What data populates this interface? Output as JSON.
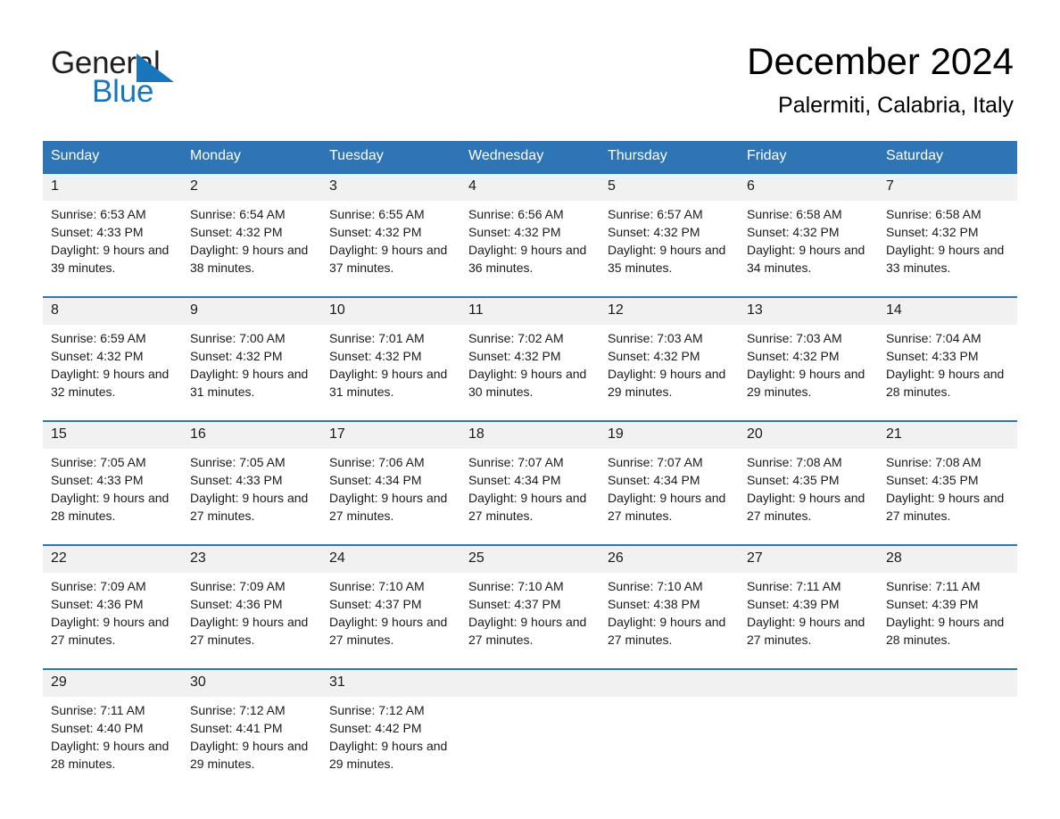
{
  "brand": {
    "name_top": "General",
    "name_bottom": "Blue",
    "triangle_icon": "triangle-logo-mark",
    "black": "#231f20",
    "blue": "#1a76bc"
  },
  "header": {
    "month_title": "December 2024",
    "location": "Palermiti, Calabria, Italy"
  },
  "theme": {
    "header_blue": "#2e75b6",
    "row_band_gray": "#f1f1f1",
    "text": "#1a1a1a"
  },
  "weekday_headers": [
    "Sunday",
    "Monday",
    "Tuesday",
    "Wednesday",
    "Thursday",
    "Friday",
    "Saturday"
  ],
  "weeks": [
    {
      "dates": [
        "1",
        "2",
        "3",
        "4",
        "5",
        "6",
        "7"
      ],
      "cells": [
        {
          "sunrise": "Sunrise: 6:53 AM",
          "sunset": "Sunset: 4:33 PM",
          "daylight": "Daylight: 9 hours and 39 minutes."
        },
        {
          "sunrise": "Sunrise: 6:54 AM",
          "sunset": "Sunset: 4:32 PM",
          "daylight": "Daylight: 9 hours and 38 minutes."
        },
        {
          "sunrise": "Sunrise: 6:55 AM",
          "sunset": "Sunset: 4:32 PM",
          "daylight": "Daylight: 9 hours and 37 minutes."
        },
        {
          "sunrise": "Sunrise: 6:56 AM",
          "sunset": "Sunset: 4:32 PM",
          "daylight": "Daylight: 9 hours and 36 minutes."
        },
        {
          "sunrise": "Sunrise: 6:57 AM",
          "sunset": "Sunset: 4:32 PM",
          "daylight": "Daylight: 9 hours and 35 minutes."
        },
        {
          "sunrise": "Sunrise: 6:58 AM",
          "sunset": "Sunset: 4:32 PM",
          "daylight": "Daylight: 9 hours and 34 minutes."
        },
        {
          "sunrise": "Sunrise: 6:58 AM",
          "sunset": "Sunset: 4:32 PM",
          "daylight": "Daylight: 9 hours and 33 minutes."
        }
      ]
    },
    {
      "dates": [
        "8",
        "9",
        "10",
        "11",
        "12",
        "13",
        "14"
      ],
      "cells": [
        {
          "sunrise": "Sunrise: 6:59 AM",
          "sunset": "Sunset: 4:32 PM",
          "daylight": "Daylight: 9 hours and 32 minutes."
        },
        {
          "sunrise": "Sunrise: 7:00 AM",
          "sunset": "Sunset: 4:32 PM",
          "daylight": "Daylight: 9 hours and 31 minutes."
        },
        {
          "sunrise": "Sunrise: 7:01 AM",
          "sunset": "Sunset: 4:32 PM",
          "daylight": "Daylight: 9 hours and 31 minutes."
        },
        {
          "sunrise": "Sunrise: 7:02 AM",
          "sunset": "Sunset: 4:32 PM",
          "daylight": "Daylight: 9 hours and 30 minutes."
        },
        {
          "sunrise": "Sunrise: 7:03 AM",
          "sunset": "Sunset: 4:32 PM",
          "daylight": "Daylight: 9 hours and 29 minutes."
        },
        {
          "sunrise": "Sunrise: 7:03 AM",
          "sunset": "Sunset: 4:32 PM",
          "daylight": "Daylight: 9 hours and 29 minutes."
        },
        {
          "sunrise": "Sunrise: 7:04 AM",
          "sunset": "Sunset: 4:33 PM",
          "daylight": "Daylight: 9 hours and 28 minutes."
        }
      ]
    },
    {
      "dates": [
        "15",
        "16",
        "17",
        "18",
        "19",
        "20",
        "21"
      ],
      "cells": [
        {
          "sunrise": "Sunrise: 7:05 AM",
          "sunset": "Sunset: 4:33 PM",
          "daylight": "Daylight: 9 hours and 28 minutes."
        },
        {
          "sunrise": "Sunrise: 7:05 AM",
          "sunset": "Sunset: 4:33 PM",
          "daylight": "Daylight: 9 hours and 27 minutes."
        },
        {
          "sunrise": "Sunrise: 7:06 AM",
          "sunset": "Sunset: 4:34 PM",
          "daylight": "Daylight: 9 hours and 27 minutes."
        },
        {
          "sunrise": "Sunrise: 7:07 AM",
          "sunset": "Sunset: 4:34 PM",
          "daylight": "Daylight: 9 hours and 27 minutes."
        },
        {
          "sunrise": "Sunrise: 7:07 AM",
          "sunset": "Sunset: 4:34 PM",
          "daylight": "Daylight: 9 hours and 27 minutes."
        },
        {
          "sunrise": "Sunrise: 7:08 AM",
          "sunset": "Sunset: 4:35 PM",
          "daylight": "Daylight: 9 hours and 27 minutes."
        },
        {
          "sunrise": "Sunrise: 7:08 AM",
          "sunset": "Sunset: 4:35 PM",
          "daylight": "Daylight: 9 hours and 27 minutes."
        }
      ]
    },
    {
      "dates": [
        "22",
        "23",
        "24",
        "25",
        "26",
        "27",
        "28"
      ],
      "cells": [
        {
          "sunrise": "Sunrise: 7:09 AM",
          "sunset": "Sunset: 4:36 PM",
          "daylight": "Daylight: 9 hours and 27 minutes."
        },
        {
          "sunrise": "Sunrise: 7:09 AM",
          "sunset": "Sunset: 4:36 PM",
          "daylight": "Daylight: 9 hours and 27 minutes."
        },
        {
          "sunrise": "Sunrise: 7:10 AM",
          "sunset": "Sunset: 4:37 PM",
          "daylight": "Daylight: 9 hours and 27 minutes."
        },
        {
          "sunrise": "Sunrise: 7:10 AM",
          "sunset": "Sunset: 4:37 PM",
          "daylight": "Daylight: 9 hours and 27 minutes."
        },
        {
          "sunrise": "Sunrise: 7:10 AM",
          "sunset": "Sunset: 4:38 PM",
          "daylight": "Daylight: 9 hours and 27 minutes."
        },
        {
          "sunrise": "Sunrise: 7:11 AM",
          "sunset": "Sunset: 4:39 PM",
          "daylight": "Daylight: 9 hours and 27 minutes."
        },
        {
          "sunrise": "Sunrise: 7:11 AM",
          "sunset": "Sunset: 4:39 PM",
          "daylight": "Daylight: 9 hours and 28 minutes."
        }
      ]
    },
    {
      "dates": [
        "29",
        "30",
        "31",
        "",
        "",
        "",
        ""
      ],
      "cells": [
        {
          "sunrise": "Sunrise: 7:11 AM",
          "sunset": "Sunset: 4:40 PM",
          "daylight": "Daylight: 9 hours and 28 minutes."
        },
        {
          "sunrise": "Sunrise: 7:12 AM",
          "sunset": "Sunset: 4:41 PM",
          "daylight": "Daylight: 9 hours and 29 minutes."
        },
        {
          "sunrise": "Sunrise: 7:12 AM",
          "sunset": "Sunset: 4:42 PM",
          "daylight": "Daylight: 9 hours and 29 minutes."
        },
        {
          "sunrise": "",
          "sunset": "",
          "daylight": ""
        },
        {
          "sunrise": "",
          "sunset": "",
          "daylight": ""
        },
        {
          "sunrise": "",
          "sunset": "",
          "daylight": ""
        },
        {
          "sunrise": "",
          "sunset": "",
          "daylight": ""
        }
      ]
    }
  ]
}
